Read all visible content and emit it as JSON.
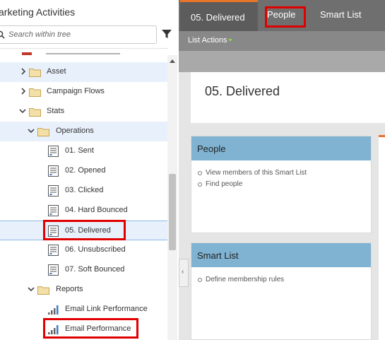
{
  "tree_panel": {
    "title": "arketing Activities",
    "search_placeholder": "Search within tree",
    "items": [
      {
        "label": "Asset"
      },
      {
        "label": "Campaign Flows"
      },
      {
        "label": "Stats"
      },
      {
        "label": "Operations"
      },
      {
        "label": "01. Sent"
      },
      {
        "label": "02. Opened"
      },
      {
        "label": "03. Clicked"
      },
      {
        "label": "04. Hard Bounced"
      },
      {
        "label": "05. Delivered"
      },
      {
        "label": "06. Unsubscribed"
      },
      {
        "label": "07. Soft Bounced"
      },
      {
        "label": "Reports"
      },
      {
        "label": "Email Link Performance"
      },
      {
        "label": "Email Performance"
      }
    ]
  },
  "tabs": {
    "active": "05. Delivered",
    "people": "People",
    "smart_list": "Smart List"
  },
  "toolbar": {
    "list_actions": "List Actions"
  },
  "header": {
    "title": "05. Delivered"
  },
  "cards": {
    "people": {
      "title": "People",
      "items": [
        "View members of this Smart List",
        "Find people"
      ]
    },
    "smart_list": {
      "title": "Smart List",
      "items": [
        "Define membership rules"
      ]
    }
  },
  "colors": {
    "accent_orange": "#e8742a",
    "card_header_blue": "#7fb3d1",
    "highlight_red": "#e00000",
    "selection_blue": "#e8f1fb"
  },
  "icons": [
    "search-icon",
    "filter-icon",
    "chevron-right-icon",
    "chevron-down-icon",
    "folder-icon",
    "smart-list-icon",
    "report-icon",
    "scroll-up-icon",
    "collapse-left-icon"
  ]
}
